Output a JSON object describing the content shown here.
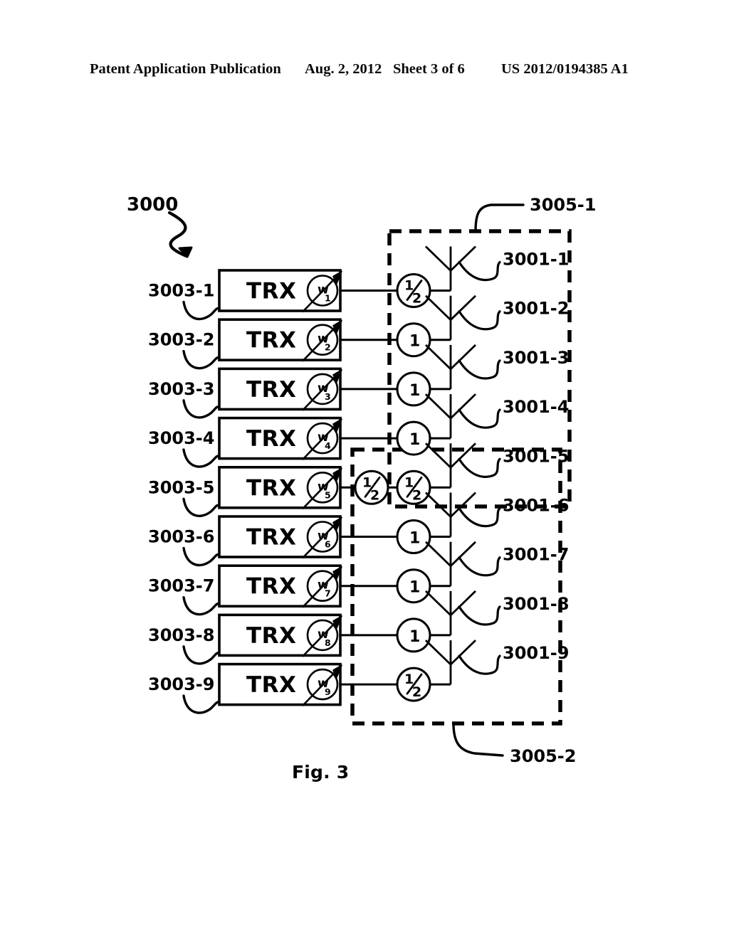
{
  "header": {
    "publication": "Patent Application Publication",
    "date": "Aug. 2, 2012",
    "sheet": "Sheet 3 of 6",
    "number": "US 2012/0194385 A1"
  },
  "figure": {
    "caption": "Fig. 3",
    "system_label": "3000",
    "system_arrow_icon": "squiggle-arrow-icon"
  },
  "colors": {
    "ink": "#000000",
    "paper": "#ffffff"
  },
  "transceivers": {
    "box_label": "TRX",
    "weight_symbol": "w",
    "items": [
      {
        "ref": "3003-1",
        "weight": "w",
        "index": "1"
      },
      {
        "ref": "3003-2",
        "weight": "w",
        "index": "2"
      },
      {
        "ref": "3003-3",
        "weight": "w",
        "index": "3"
      },
      {
        "ref": "3003-4",
        "weight": "w",
        "index": "4"
      },
      {
        "ref": "3003-5",
        "weight": "w",
        "index": "5"
      },
      {
        "ref": "3003-6",
        "weight": "w",
        "index": "6"
      },
      {
        "ref": "3003-7",
        "weight": "w",
        "index": "7"
      },
      {
        "ref": "3003-8",
        "weight": "w",
        "index": "8"
      },
      {
        "ref": "3003-9",
        "weight": "w",
        "index": "9"
      }
    ]
  },
  "antennas": {
    "items": [
      {
        "ref": "3001-1"
      },
      {
        "ref": "3001-2"
      },
      {
        "ref": "3001-3"
      },
      {
        "ref": "3001-4"
      },
      {
        "ref": "3001-5"
      },
      {
        "ref": "3001-6"
      },
      {
        "ref": "3001-7"
      },
      {
        "ref": "3001-8"
      },
      {
        "ref": "3001-9"
      }
    ]
  },
  "gain_elements": {
    "half_numerator": "1",
    "half_denominator": "2",
    "unity": "1",
    "per_row": [
      {
        "row": 1,
        "values": [
          "1/2"
        ]
      },
      {
        "row": 2,
        "values": [
          "1"
        ]
      },
      {
        "row": 3,
        "values": [
          "1"
        ]
      },
      {
        "row": 4,
        "values": [
          "1"
        ]
      },
      {
        "row": 5,
        "values": [
          "1/2",
          "1/2"
        ]
      },
      {
        "row": 6,
        "values": [
          "1"
        ]
      },
      {
        "row": 7,
        "values": [
          "1"
        ]
      },
      {
        "row": 8,
        "values": [
          "1"
        ]
      },
      {
        "row": 9,
        "values": [
          "1/2"
        ]
      }
    ]
  },
  "groups": [
    {
      "ref": "3005-1",
      "covers_antennas": [
        "3001-1",
        "3001-2",
        "3001-3",
        "3001-4",
        "3001-5"
      ]
    },
    {
      "ref": "3005-2",
      "covers_antennas": [
        "3001-5",
        "3001-6",
        "3001-7",
        "3001-8",
        "3001-9"
      ]
    }
  ]
}
